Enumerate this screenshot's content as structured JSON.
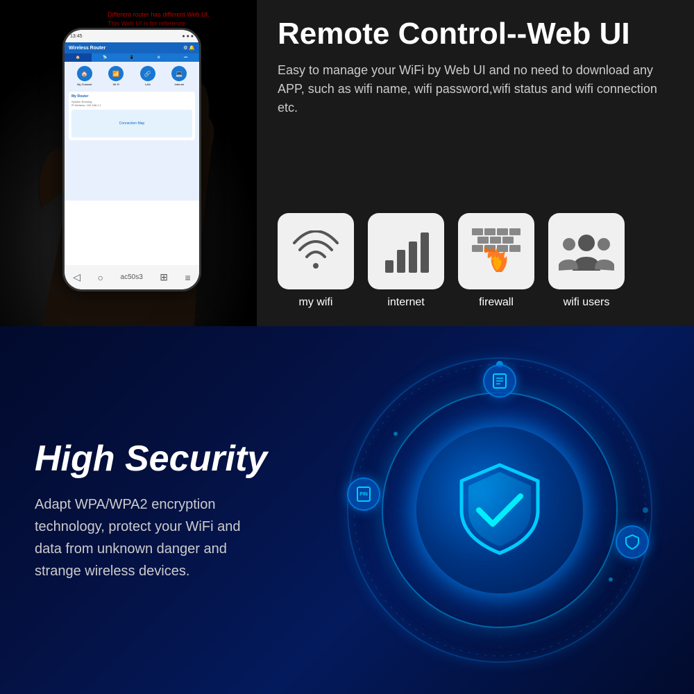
{
  "top": {
    "disclaimer": "Different router has different Web UI.\nThis Web UI is for reference.",
    "phone_time": "13:45",
    "phone_title": "Wireless Router",
    "title": "Remote Control--Web UI",
    "description": "Easy to manage your WiFi by Web UI and no need to download any APP, such as wifi name, wifi password,wifi status and wifi connection etc.",
    "features": [
      {
        "id": "my-wifi",
        "icon": "📶",
        "label": "my wifi",
        "unicode": "📡"
      },
      {
        "id": "internet",
        "icon": "📊",
        "label": "internet",
        "unicode": "📊"
      },
      {
        "id": "firewall",
        "icon": "🔥",
        "label": "firewall",
        "unicode": "🧱"
      },
      {
        "id": "wifi-users",
        "icon": "👥",
        "label": "wifi users",
        "unicode": "👥"
      }
    ]
  },
  "bottom": {
    "title": "High Security",
    "description": "Adapt WPA/WPA2 encryption technology, protect your WiFi and data from unknown danger and strange wireless devices.",
    "floating_icons": [
      {
        "id": "top-icon",
        "symbol": "📋",
        "position": "top"
      },
      {
        "id": "left-icon",
        "symbol": "📌",
        "position": "left"
      },
      {
        "id": "right-icon",
        "symbol": "🛡",
        "position": "right"
      }
    ]
  }
}
